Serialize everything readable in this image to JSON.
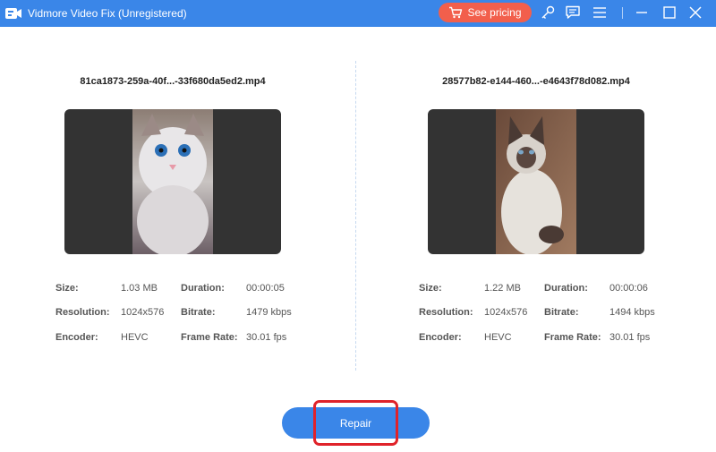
{
  "window": {
    "title": "Vidmore Video Fix (Unregistered)",
    "pricing_label": "See pricing"
  },
  "colors": {
    "titlebar": "#3a86e8",
    "pricing_button": "#f25f4c",
    "repair_button": "#3a86e8",
    "highlight": "#e0232a"
  },
  "icons": {
    "logo": "video-logo-icon",
    "cart": "cart-icon",
    "register": "key-icon",
    "feedback": "chat-icon",
    "menu": "menu-icon",
    "minimize": "minimize-icon",
    "maximize": "maximize-icon",
    "close": "close-icon"
  },
  "labels": {
    "size": "Size:",
    "resolution": "Resolution:",
    "encoder": "Encoder:",
    "duration": "Duration:",
    "bitrate": "Bitrate:",
    "frame_rate": "Frame Rate:"
  },
  "left": {
    "filename": "81ca1873-259a-40f...-33f680da5ed2.mp4",
    "size": "1.03 MB",
    "resolution": "1024x576",
    "encoder": "HEVC",
    "duration": "00:00:05",
    "bitrate": "1479 kbps",
    "frame_rate": "30.01 fps"
  },
  "right": {
    "filename": "28577b82-e144-460...-e4643f78d082.mp4",
    "size": "1.22 MB",
    "resolution": "1024x576",
    "encoder": "HEVC",
    "duration": "00:00:06",
    "bitrate": "1494 kbps",
    "frame_rate": "30.01 fps"
  },
  "repair_label": "Repair"
}
